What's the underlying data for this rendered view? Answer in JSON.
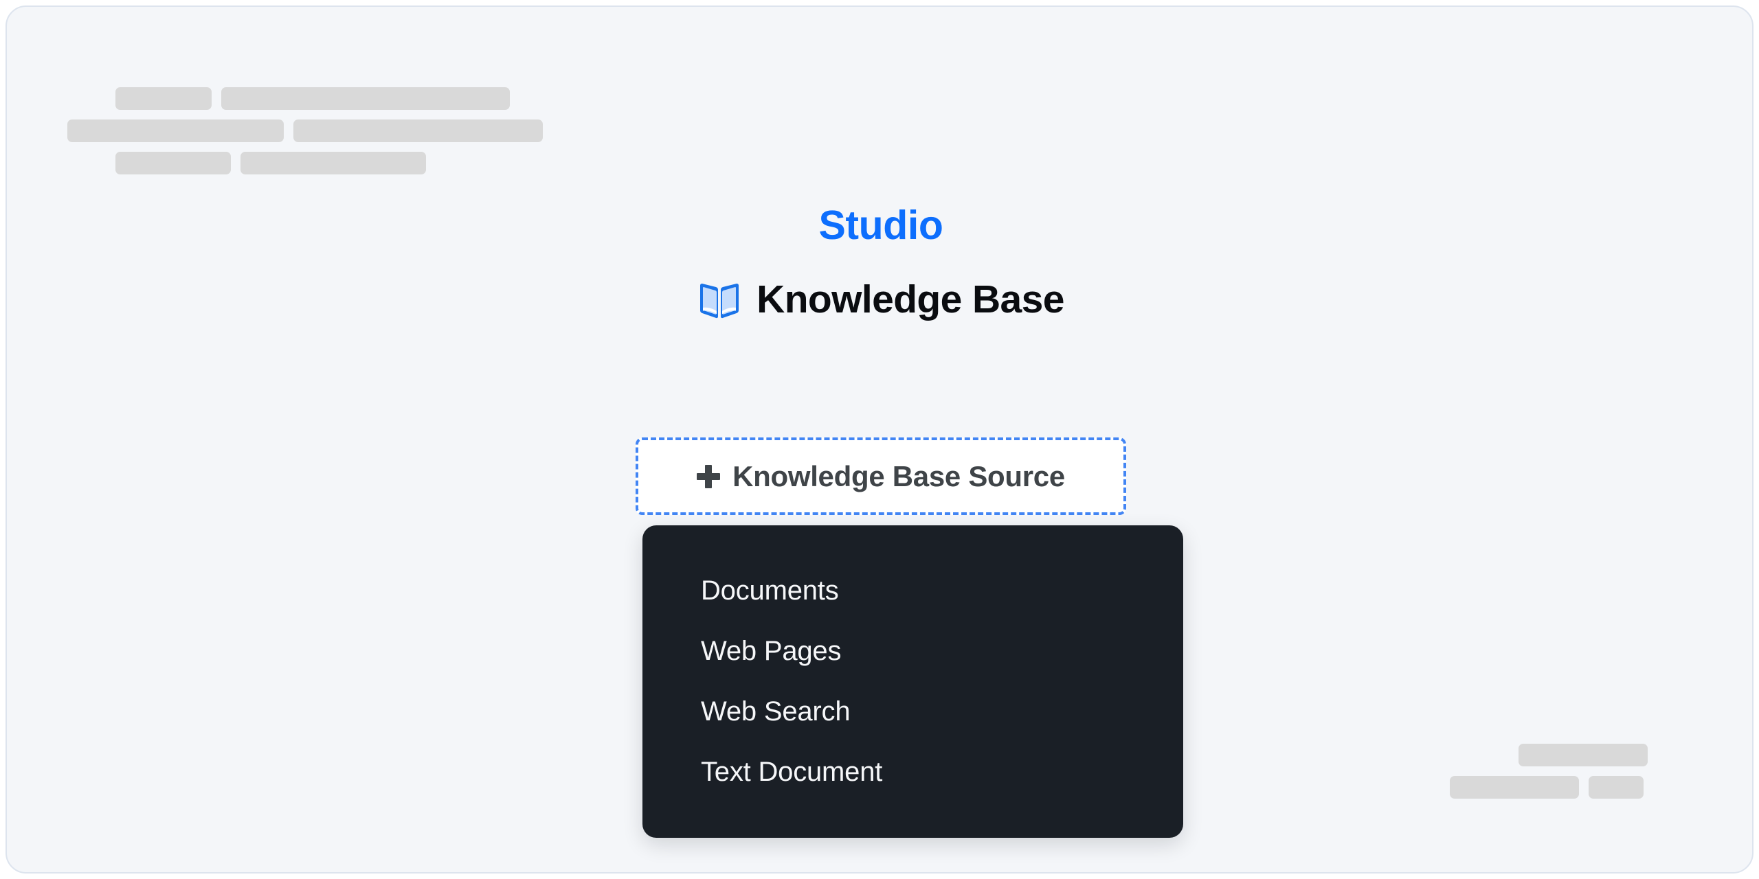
{
  "app": {
    "brand_title": "Studio",
    "brand_color": "#0d6efd",
    "card_background": "#f4f6f9",
    "card_border_color": "#dde4ee"
  },
  "heading": {
    "icon": "open-book-icon",
    "icon_color": "#1a73e8",
    "icon_page_color": "#bcd7fb",
    "text": "Knowledge Base"
  },
  "add_source_button": {
    "icon": "plus-icon",
    "label": "Knowledge Base Source",
    "border_color": "#4285f4",
    "background": "#ffffff",
    "text_color": "#3f4448",
    "border_style": "dashed"
  },
  "source_menu": {
    "background": "#1a1f26",
    "text_color": "#f6f7f9",
    "items": [
      {
        "label": "Documents"
      },
      {
        "label": "Web Pages"
      },
      {
        "label": "Web Search"
      },
      {
        "label": "Text Document"
      }
    ]
  },
  "skeleton": {
    "bar_color": "#d9d9d9",
    "top_left": {
      "rows": [
        {
          "indent": 70,
          "bars": [
            140,
            420
          ]
        },
        {
          "indent": 0,
          "bars": [
            315,
            363
          ]
        },
        {
          "indent": 70,
          "bars": [
            168,
            270
          ]
        }
      ]
    },
    "bottom_right": {
      "rows": [
        {
          "indent": 100,
          "bars": [
            188
          ]
        },
        {
          "indent": 0,
          "bars": [
            188,
            80
          ]
        }
      ]
    }
  }
}
